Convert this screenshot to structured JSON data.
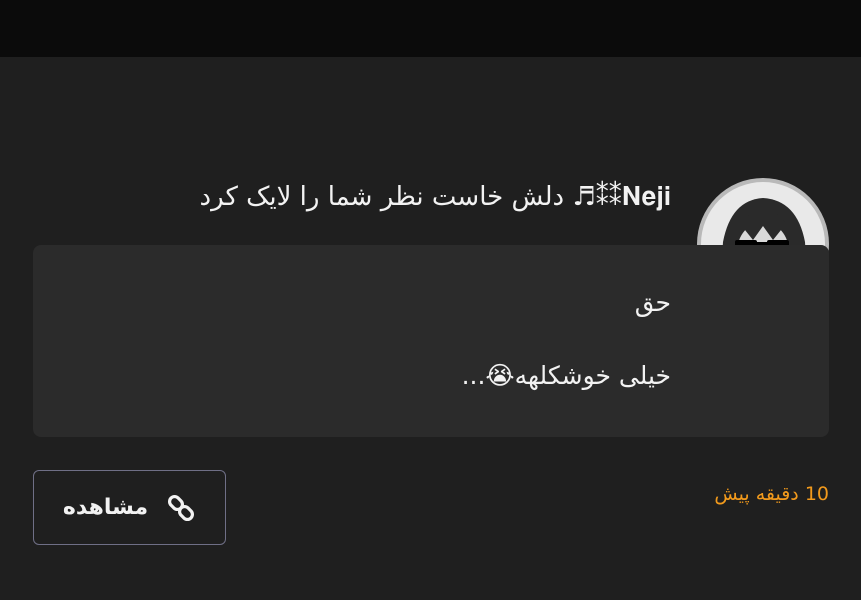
{
  "notification": {
    "username": "𝐍𝐞𝐣𝐢⁑⁑♬",
    "message": " دلش خاست نظر شما را لایک کرد"
  },
  "comment": {
    "line1": "حق",
    "line2": "خیلی خوشکلهه😭..."
  },
  "time_ago": "10 دقیقه پیش",
  "view_button": {
    "label": "مشاهده",
    "icon": "link-icon"
  },
  "avatar": {
    "icon": "avatar-anime-girl-sunglasses"
  },
  "colors": {
    "background": "#1f1f1f",
    "top_bar": "#0b0b0b",
    "comment_box": "#2b2b2b",
    "text": "#f2f2f2",
    "time_accent": "#f29a1c",
    "button_border": "#6f6f86"
  }
}
